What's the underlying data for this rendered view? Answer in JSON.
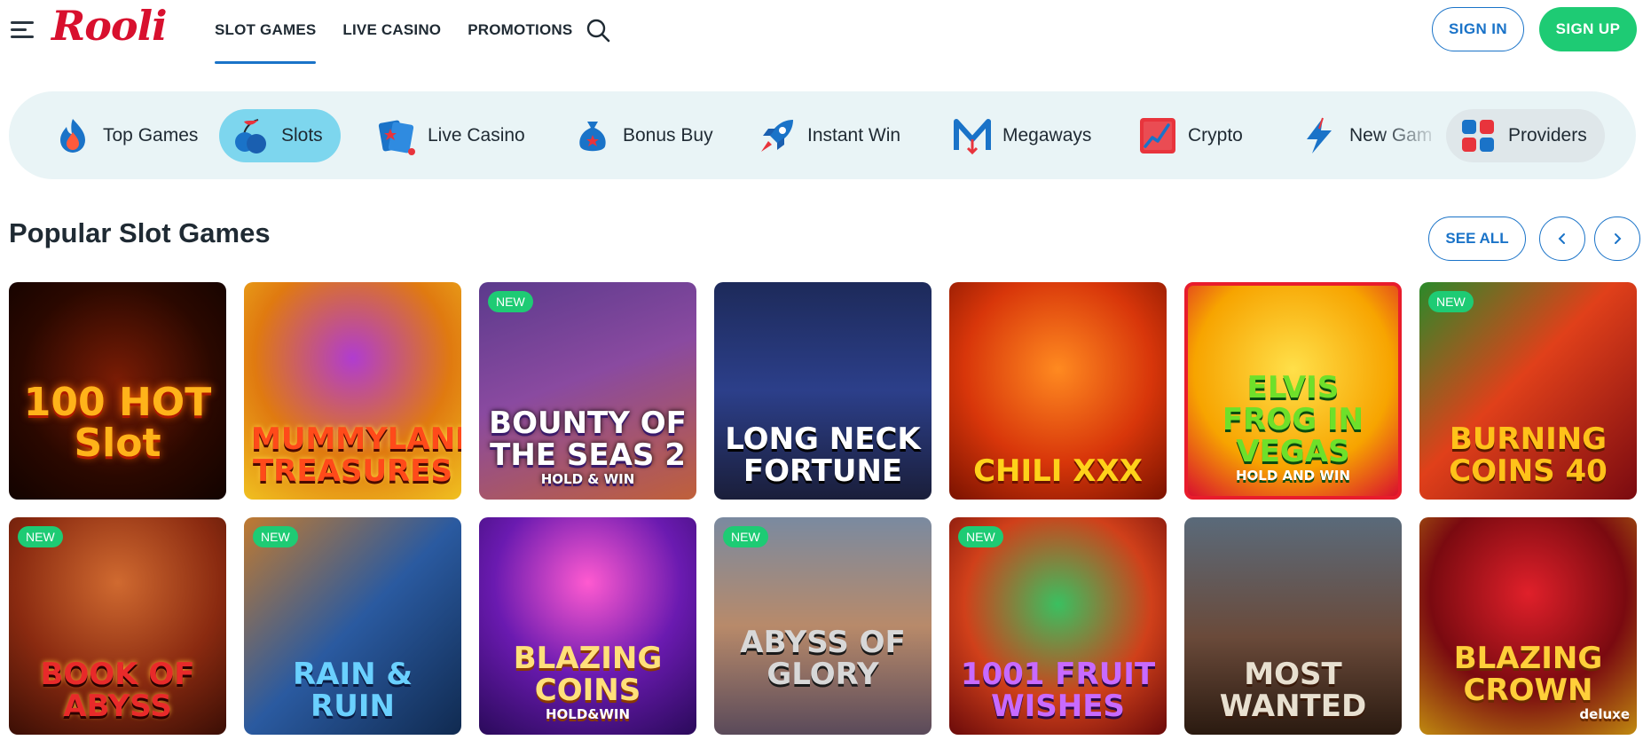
{
  "brand": {
    "logo": "Rooli",
    "logo_color": "#d8102e",
    "accent": "#1a73c8",
    "green": "#1ecb74"
  },
  "nav": [
    {
      "label": "SLOT GAMES",
      "active": true
    },
    {
      "label": "LIVE CASINO",
      "active": false
    },
    {
      "label": "PROMOTIONS",
      "active": false
    }
  ],
  "auth": {
    "signin": "SIGN IN",
    "signup": "SIGN UP"
  },
  "categories": [
    {
      "label": "Top Games",
      "icon": "flame-icon"
    },
    {
      "label": "Slots",
      "icon": "cherries-icon",
      "active": true
    },
    {
      "label": "Live Casino",
      "icon": "cards-icon"
    },
    {
      "label": "Bonus Buy",
      "icon": "money-bag-icon"
    },
    {
      "label": "Instant Win",
      "icon": "rocket-icon"
    },
    {
      "label": "Megaways",
      "icon": "megaways-icon"
    },
    {
      "label": "Crypto",
      "icon": "chart-icon"
    },
    {
      "label": "New Gam",
      "icon": "lightning-icon"
    },
    {
      "label": "Providers",
      "icon": "grid-icon"
    }
  ],
  "section": {
    "title": "Popular Slot Games",
    "see_all": "SEE ALL"
  },
  "games": [
    {
      "title": "100 HOT Slot",
      "new": false
    },
    {
      "title": "MUMMYLAND TREASURES",
      "new": false
    },
    {
      "title": "BOUNTY OF THE SEAS 2",
      "sub": "HOLD & WIN",
      "new": true
    },
    {
      "title": "LONG NECK FORTUNE",
      "new": false
    },
    {
      "title": "CHILI XXX",
      "new": false
    },
    {
      "title": "ELVIS FROG IN VEGAS",
      "sub": "HOLD AND WIN",
      "new": false
    },
    {
      "title": "BURNING COINS 40",
      "new": true
    },
    {
      "title": "BOOK OF ABYSS",
      "new": true
    },
    {
      "title": "RAIN & RUIN",
      "new": true
    },
    {
      "title": "BLAZING COINS",
      "sub": "HOLD&WIN",
      "new": false
    },
    {
      "title": "ABYSS OF GLORY",
      "new": true
    },
    {
      "title": "1001 FRUIT WISHES",
      "new": true
    },
    {
      "title": "MOST WANTED",
      "new": false
    },
    {
      "title": "BLAZING CROWN",
      "sub": "deluxe",
      "new": false
    }
  ],
  "new_badge": "NEW"
}
